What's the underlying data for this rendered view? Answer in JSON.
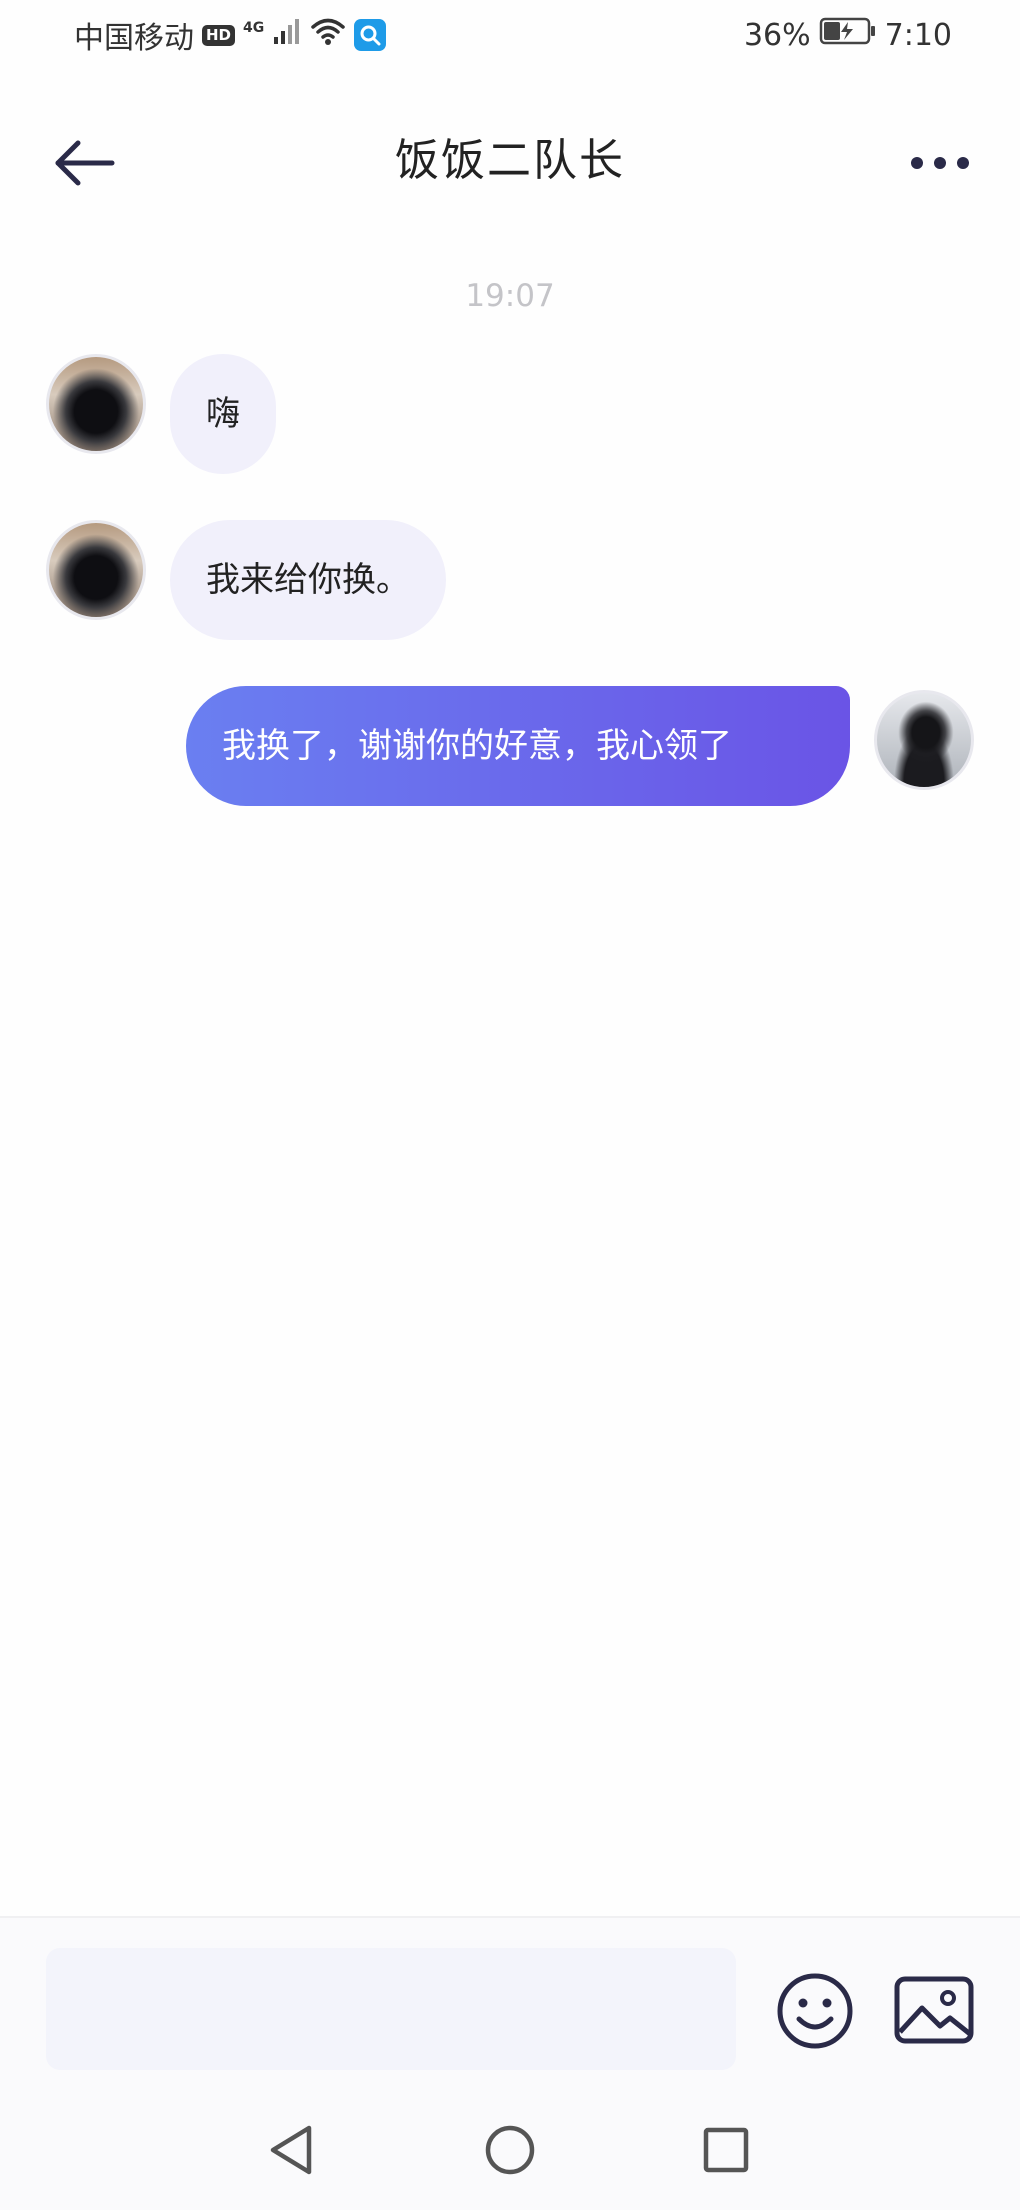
{
  "status_bar": {
    "carrier": "中国移动",
    "hd_badge": "HD",
    "network_label": "4G",
    "battery_percent": "36%",
    "time": "7:10",
    "icons": [
      "signal-icon",
      "wifi-icon",
      "search-app-icon",
      "battery-charging-icon"
    ]
  },
  "header": {
    "title": "饭饭二队长",
    "icons": [
      "back-arrow-icon",
      "more-dots-icon"
    ]
  },
  "conversation": {
    "timestamp": "19:07",
    "messages": [
      {
        "direction": "incoming",
        "text": "嗨"
      },
      {
        "direction": "incoming",
        "text": "我来给你换。"
      },
      {
        "direction": "outgoing",
        "text": "我换了，谢谢你的好意，我心领了"
      }
    ]
  },
  "composer": {
    "input_value": "",
    "icons": [
      "emoji-icon",
      "image-icon"
    ]
  },
  "system_nav": {
    "icons": [
      "back-triangle-icon",
      "home-circle-icon",
      "recents-square-icon"
    ]
  },
  "colors": {
    "accent_gradient_start": "#6a7ff1",
    "accent_gradient_end": "#6a54e6",
    "incoming_bubble": "#f1f0fb",
    "icon_dark": "#2a2a48",
    "timestamp_gray": "#c4c4c8"
  }
}
